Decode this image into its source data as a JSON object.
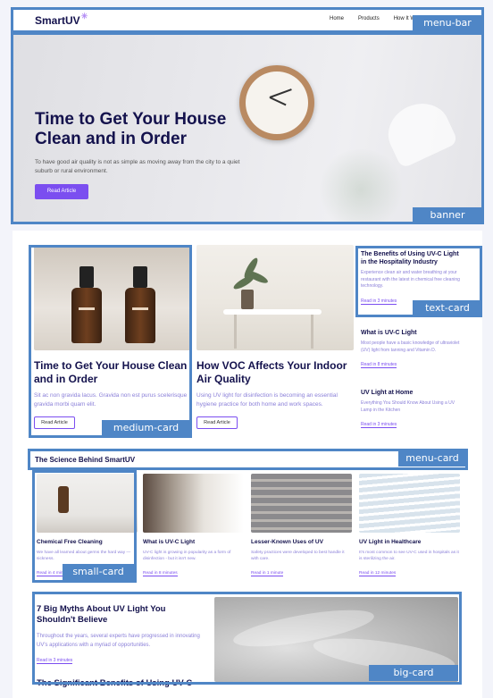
{
  "menu_bar": {
    "logo": "SmartUV",
    "logo_spark": "✳",
    "nav": [
      "Home",
      "Products",
      "How It Work"
    ],
    "tag": "menu-bar"
  },
  "banner": {
    "title": "Time to Get Your House Clean and in Order",
    "description": "To have good air quality is not as simple as moving away from the city to a quiet suburb or rural environment.",
    "button": "Read Article",
    "tag": "banner"
  },
  "medium_cards": [
    {
      "title": "Time to Get Your House Clean and in Order",
      "description": "Sit ac non gravida lacus. Gravida non est purus scelerisque gravida morbi quam elit.",
      "button": "Read Article"
    },
    {
      "title": "How VOC Affects Your Indoor Air Quality",
      "description": "Using UV light for disinfection is becoming an essential hygiene practice for both home and work spaces.",
      "button": "Read Article"
    }
  ],
  "medium_card_tag": "medium-card",
  "text_cards": [
    {
      "title": "The Benefits of Using UV-C Light in the Hospitality Industry",
      "description": "Experience clean air and water breathing at your restaurant with the latest in chemical free cleaning technology.",
      "link": "Read in 3 minutes"
    },
    {
      "title": "What is UV-C Light",
      "description": "Most people have a basic knowledge of ultraviolet (UV) light from tanning and Vitamin D.",
      "link": "Read in 8 minutes"
    },
    {
      "title": "UV Light at Home",
      "description": "Everything You Should Know About Using a UV Lamp in the Kitchen",
      "link": "Read in 3 minutes"
    }
  ],
  "text_card_tag": "text-card",
  "menu_card": {
    "title": "The Science Behind SmartUV",
    "tag": "menu-card"
  },
  "small_cards": [
    {
      "title": "Chemical Free Cleaning",
      "description": "We have all learned about germs the hard way — sickness.",
      "link": "Read in 4 minutes"
    },
    {
      "title": "What is UV-C Light",
      "description": "UV-C light is growing in popularity as a form of disinfection - but it isn't new.",
      "link": "Read in 8 minutes"
    },
    {
      "title": "Lesser-Known Uses of UV",
      "description": "Safety practices were developed to best handle it with care.",
      "link": "Read in 1 minute"
    },
    {
      "title": "UV Light in Healthcare",
      "description": "It's most common to see UV-C used in hospitals as it is sterilizing the air.",
      "link": "Read in 12 minutes"
    }
  ],
  "small_card_tag": "small-card",
  "big_card": {
    "title": "7 Big Myths About UV Light You Shouldn't Believe",
    "description": "Throughout the years, several experts have progressed in innovating UV's applications with a myriad of opportunities.",
    "link": "Read in 3 minutes",
    "next_title": "The Significant Benefits of Using UV-C",
    "tag": "big-card"
  },
  "colors": {
    "annotation": "#4f86c6",
    "accent": "#7b4ef0",
    "heading": "#14124d",
    "muted_text": "#8a7fd8"
  }
}
